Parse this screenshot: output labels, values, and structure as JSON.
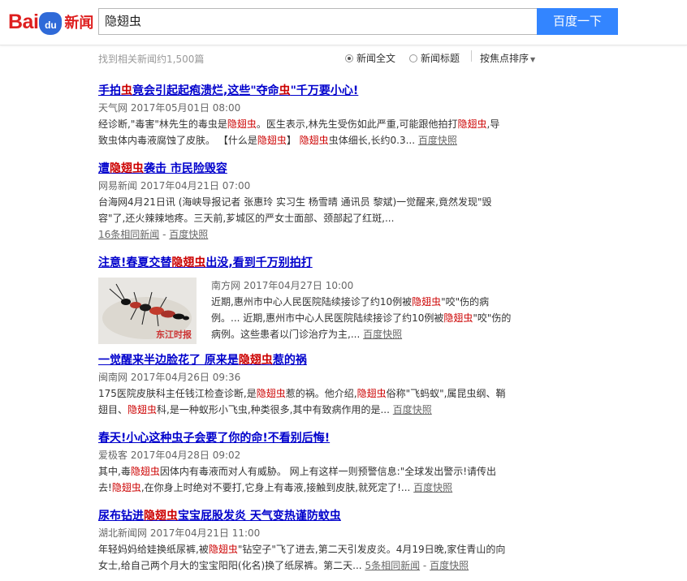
{
  "header": {
    "logo_bai": "Bai",
    "logo_du": "du",
    "logo_news": "新闻",
    "search_value": "隐翅虫",
    "search_button": "百度一下"
  },
  "toolbar": {
    "result_count": "找到相关新闻约1,500篇",
    "option_full": "新闻全文",
    "option_title": "新闻标题",
    "sort_label": "按焦点排序"
  },
  "results": [
    {
      "title_a": "手拍",
      "title_b": "虫",
      "title_c": "竟会引起起疱溃烂,这些\"夺命",
      "title_d": "虫",
      "title_e": "\"千万要小心!",
      "meta": "天气网  2017年05月01日 08:00",
      "line1_a": "经诊断,\"毒害\"林先生的毒虫是",
      "line1_b": "隐翅虫",
      "line1_c": "。医生表示,林先生受伤如此严重,可能跟他拍打",
      "line1_d": "隐翅虫",
      "line1_e": ",导",
      "line2_a": "致虫体内毒液腐蚀了皮肤。 【什么是",
      "line2_b": "隐翅虫",
      "line2_c": "】 ",
      "line2_d": "隐翅虫",
      "line2_e": "虫体细长,长约0.3...",
      "snapshot": "百度快照"
    },
    {
      "title_a": "遭",
      "title_b": "隐翅虫",
      "title_c": "袭击 市民险毁容",
      "meta": "网易新闻  2017年04月21日 07:00",
      "line1": "台海网4月21日讯 (海峡导报记者 张惠玲 实习生 杨雪晴 通讯员 黎斌)一觉醒来,竟然发现\"毁",
      "line2": "容\"了,还火辣辣地疼。三天前,芗城区的严女士面部、颈部起了红斑,...",
      "related": "16条相同新闻",
      "snapshot": "百度快照"
    },
    {
      "title_a": "注意!春夏交替",
      "title_b": "隐翅虫",
      "title_c": "出没,看到千万别拍打",
      "meta": "南方网  2017年04月27日 10:00",
      "line1_a": "近期,惠州市中心人民医院陆续接诊了约10例被",
      "line1_b": "隐翅虫",
      "line1_c": "\"咬\"伤的病",
      "line2_a": "例。... 近期,惠州市中心人民医院陆续接诊了约10例被",
      "line2_b": "隐翅虫",
      "line2_c": "\"咬\"伤的",
      "line3": "病例。这些患者以门诊治疗为主,...",
      "snapshot": "百度快照",
      "image_caption": "东江时报"
    },
    {
      "title_a": "一觉醒来半边脸花了 原来是",
      "title_b": "隐翅虫",
      "title_c": "惹的祸",
      "meta": "闽南网  2017年04月26日 09:36",
      "line1_a": "175医院皮肤科主任钱江检查诊断,是",
      "line1_b": "隐翅虫",
      "line1_c": "惹的祸。他介绍,",
      "line1_d": "隐翅虫",
      "line1_e": "俗称\"飞蚂蚁\",属昆虫纲、鞘",
      "line2_a": "翅目、",
      "line2_b": "隐翅虫",
      "line2_c": "科,是一种蚁形小飞虫,种类很多,其中有致病作用的是...",
      "snapshot": "百度快照"
    },
    {
      "title": "春天!小心这种虫子会要了你的命!不看别后悔!",
      "meta": "爱极客  2017年04月28日 09:02",
      "line1_a": "其中,毒",
      "line1_b": "隐翅虫",
      "line1_c": "因体内有毒液而对人有威胁。 网上有这样一则预警信息:\"全球发出警示!请传出",
      "line2_a": "去!",
      "line2_b": "隐翅虫",
      "line2_c": ",在你身上时绝对不要打,它身上有毒液,接触到皮肤,就死定了!...",
      "snapshot": "百度快照"
    },
    {
      "title_a": "尿布钻进",
      "title_b": "隐翅虫",
      "title_c": "宝宝屁股发炎 天气变热谨防蚊虫",
      "meta": "湖北新闻网  2017年04月21日 11:00",
      "line1_a": "年轻妈妈给娃换纸尿裤,被",
      "line1_b": "隐翅虫",
      "line1_c": "\"钻空子\"飞了进去,第二天引发皮炎。4月19日晚,家住青山的向",
      "line2": "女士,给自己两个月大的宝宝阳阳(化名)换了纸尿裤。第二天...",
      "related": "5条相同新闻",
      "snapshot": "百度快照"
    }
  ]
}
